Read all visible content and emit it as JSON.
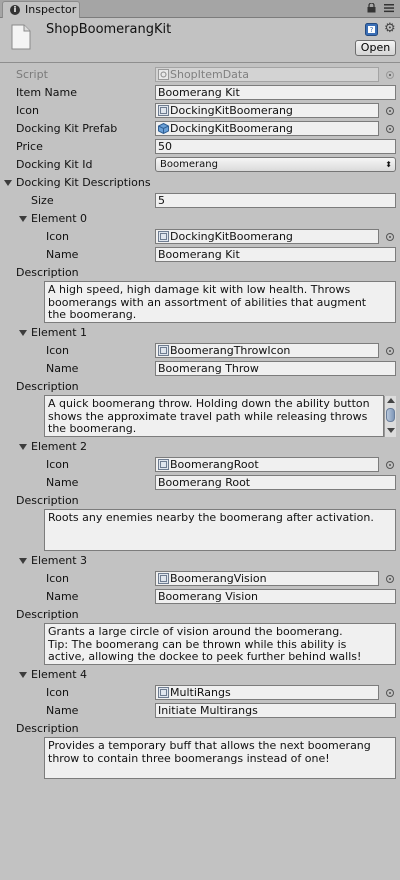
{
  "window": {
    "tab_label": "Inspector",
    "title": "ShopBoomerangKit",
    "open_label": "Open"
  },
  "fields": {
    "script": {
      "label": "Script",
      "value": "ShopItemData"
    },
    "item_name": {
      "label": "Item Name",
      "value": "Boomerang Kit"
    },
    "icon": {
      "label": "Icon",
      "value": "DockingKitBoomerang"
    },
    "prefab": {
      "label": "Docking Kit Prefab",
      "value": "DockingKitBoomerang"
    },
    "price": {
      "label": "Price",
      "value": "50"
    },
    "kit_id": {
      "label": "Docking Kit Id",
      "value": "Boomerang"
    }
  },
  "descriptions": {
    "label": "Docking Kit Descriptions",
    "size_label": "Size",
    "size_value": "5",
    "icon_label": "Icon",
    "name_label": "Name",
    "desc_label": "Description",
    "elements": [
      {
        "title": "Element 0",
        "icon": "DockingKitBoomerang",
        "name": "Boomerang Kit",
        "description": "A high speed, high damage kit with low health. Throws\nboomerangs with an assortment of abilities that augment\nthe boomerang."
      },
      {
        "title": "Element 1",
        "icon": "BoomerangThrowIcon",
        "name": "Boomerang Throw",
        "description": "A quick boomerang throw. Holding down the ability button\nshows the approximate travel path while releasing throws\nthe boomerang."
      },
      {
        "title": "Element 2",
        "icon": "BoomerangRoot",
        "name": "Boomerang Root",
        "description": "Roots any enemies nearby the boomerang after activation."
      },
      {
        "title": "Element 3",
        "icon": "BoomerangVision",
        "name": "Boomerang Vision",
        "description": "Grants a large circle of vision around the boomerang.\nTip: The boomerang can be thrown while this ability is\nactive, allowing the dockee to peek further behind walls!"
      },
      {
        "title": "Element 4",
        "icon": "MultiRangs",
        "name": "Initiate Multirangs",
        "description": "Provides a temporary buff that allows the next boomerang\nthrow to contain three boomerangs instead of one!"
      }
    ]
  },
  "icons": {
    "tab": "info-icon",
    "lock": "lock-icon",
    "menu": "menu-icon",
    "asset": "scriptable-object-file-icon",
    "help": "help-book-icon",
    "settings": "gear-icon",
    "script": "script-asset-icon",
    "sprite": "sprite-icon",
    "prefab": "prefab-cube-icon",
    "picker": "object-picker-icon"
  },
  "colors": {
    "panel_bg": "#c2c2c2",
    "field_bg": "#f0f0f0",
    "field_border": "#7c7c7c",
    "disabled_text": "#7a7a7a"
  }
}
